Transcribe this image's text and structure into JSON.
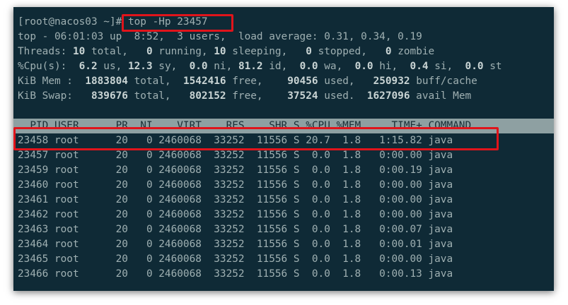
{
  "terminal": {
    "prompt": "[root@nacos03 ~]# ",
    "command": "top -Hp 23457",
    "summary": {
      "top_line": "top - 06:01:03 up  8:52,  3 users,  load average: 0.31, 0.34, 0.19",
      "threads": {
        "label": "Threads: ",
        "total": "10",
        "total_lbl": " total,   ",
        "running": "0",
        "running_lbl": " running, ",
        "sleeping": "10",
        "sleeping_lbl": " sleeping,   ",
        "stopped": "0",
        "stopped_lbl": " stopped,   ",
        "zombie": "0",
        "zombie_lbl": " zombie"
      },
      "cpu": {
        "label": "%Cpu(s):  ",
        "us": "6.2",
        "us_lbl": " us, ",
        "sy": "12.3",
        "sy_lbl": " sy,  ",
        "ni": "0.0",
        "ni_lbl": " ni, ",
        "id": "81.2",
        "id_lbl": " id,  ",
        "wa": "0.0",
        "wa_lbl": " wa,  ",
        "hi": "0.0",
        "hi_lbl": " hi,  ",
        "si": "0.4",
        "si_lbl": " si,  ",
        "st": "0.0",
        "st_lbl": " st"
      },
      "mem": {
        "label": "KiB Mem :  ",
        "total": "1883804",
        "total_lbl": " total,  ",
        "free": "1542416",
        "free_lbl": " free,    ",
        "used": "90456",
        "used_lbl": " used,   ",
        "buff": "250932",
        "buff_lbl": " buff/cache"
      },
      "swap": {
        "label": "KiB Swap:   ",
        "total": "839676",
        "total_lbl": " total,   ",
        "free": "802152",
        "free_lbl": " free,    ",
        "used": "37524",
        "used_lbl": " used.  ",
        "avail": "1627096",
        "avail_lbl": " avail Mem"
      }
    },
    "header": "  PID USER      PR  NI    VIRT    RES    SHR S %CPU %MEM     TIME+ COMMAND",
    "rows": [
      "23458 root      20   0 2460068  33252  11556 S 20.7  1.8   1:15.82 java",
      "23457 root      20   0 2460068  33252  11556 S  0.0  1.8   0:00.00 java",
      "23459 root      20   0 2460068  33252  11556 S  0.0  1.8   0:00.19 java",
      "23460 root      20   0 2460068  33252  11556 S  0.0  1.8   0:00.00 java",
      "23461 root      20   0 2460068  33252  11556 S  0.0  1.8   0:00.00 java",
      "23462 root      20   0 2460068  33252  11556 S  0.0  1.8   0:00.00 java",
      "23463 root      20   0 2460068  33252  11556 S  0.0  1.8   0:00.07 java",
      "23464 root      20   0 2460068  33252  11556 S  0.0  1.8   0:00.01 java",
      "23465 root      20   0 2460068  33252  11556 S  0.0  1.8   0:00.00 java",
      "23466 root      20   0 2460068  33252  11556 S  0.0  1.8   0:00.13 java"
    ],
    "colors": {
      "background": "#0f2a36",
      "text": "#9fb0b2",
      "header_bg": "#8ea0a2",
      "highlight": "#e0141b"
    }
  }
}
